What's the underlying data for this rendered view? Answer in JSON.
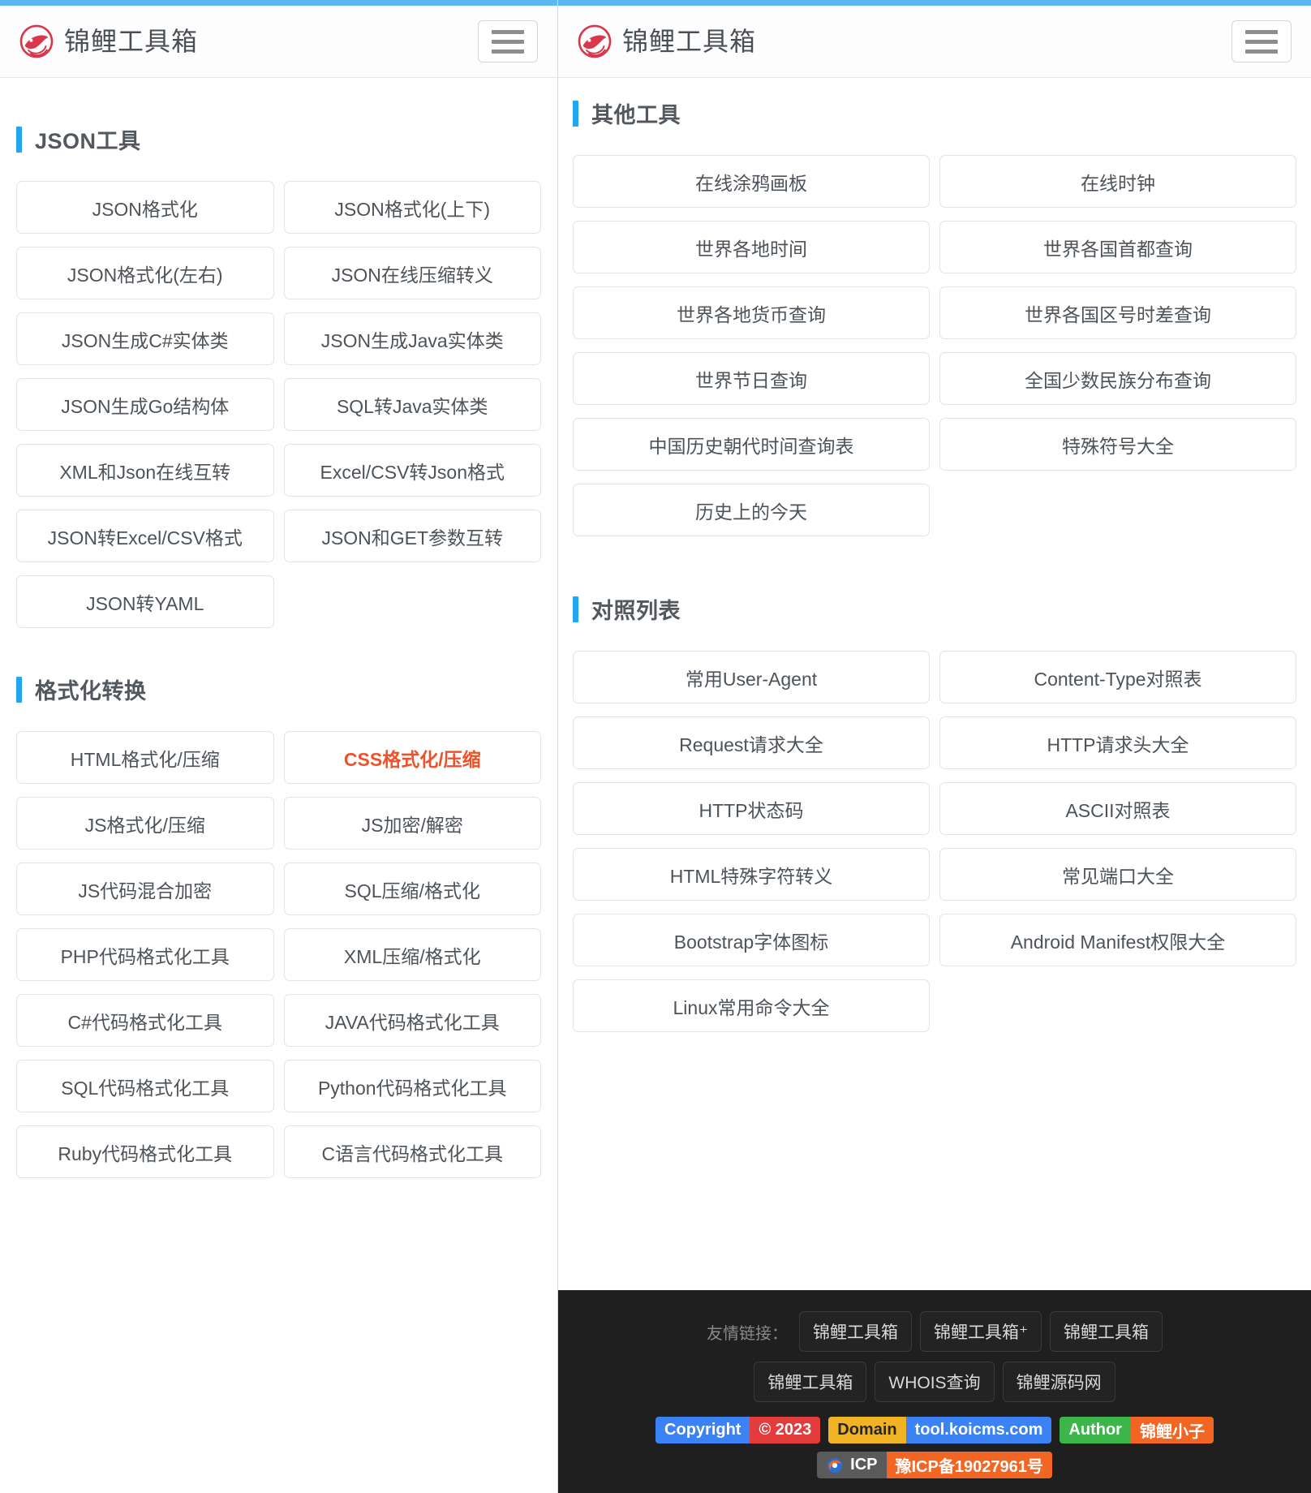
{
  "brand": {
    "title": "锦鲤工具箱",
    "logo_icon": "koi-fish-logo",
    "menu_icon": "hamburger-menu-icon"
  },
  "left_panel": {
    "sections": [
      {
        "title": "JSON工具",
        "items": [
          "JSON格式化",
          "JSON格式化(上下)",
          "JSON格式化(左右)",
          "JSON在线压缩转义",
          "JSON生成C#实体类",
          "JSON生成Java实体类",
          "JSON生成Go结构体",
          "SQL转Java实体类",
          "XML和Json在线互转",
          "Excel/CSV转Json格式",
          "JSON转Excel/CSV格式",
          "JSON和GET参数互转",
          "JSON转YAML"
        ]
      },
      {
        "title": "格式化转换",
        "items": [
          "HTML格式化/压缩",
          "CSS格式化/压缩",
          "JS格式化/压缩",
          "JS加密/解密",
          "JS代码混合加密",
          "SQL压缩/格式化",
          "PHP代码格式化工具",
          "XML压缩/格式化",
          "C#代码格式化工具",
          "JAVA代码格式化工具",
          "SQL代码格式化工具",
          "Python代码格式化工具",
          "Ruby代码格式化工具",
          "C语言代码格式化工具"
        ],
        "active_item": "CSS格式化/压缩"
      }
    ]
  },
  "right_panel": {
    "sections": [
      {
        "title": "其他工具",
        "items": [
          "在线涂鸦画板",
          "在线时钟",
          "世界各地时间",
          "世界各国首都查询",
          "世界各地货币查询",
          "世界各国区号时差查询",
          "世界节日查询",
          "全国少数民族分布查询",
          "中国历史朝代时间查询表",
          "特殊符号大全",
          "历史上的今天"
        ]
      },
      {
        "title": "对照列表",
        "items": [
          "常用User-Agent",
          "Content-Type对照表",
          "Request请求大全",
          "HTTP请求头大全",
          "HTTP状态码",
          "ASCII对照表",
          "HTML特殊字符转义",
          "常见端口大全",
          "Bootstrap字体图标",
          "Android Manifest权限大全",
          "Linux常用命令大全"
        ]
      }
    ]
  },
  "footer": {
    "friend_links_label": "友情链接：",
    "friend_links_row1": [
      "锦鲤工具箱",
      "锦鲤工具箱⁺",
      "锦鲤工具箱"
    ],
    "friend_links_row2": [
      "锦鲤工具箱",
      "WHOIS查询",
      "锦鲤源码网"
    ],
    "badges": {
      "copyright_label": "Copyright",
      "copyright_value": "© 2023",
      "domain_label": "Domain",
      "domain_value": "tool.koicms.com",
      "author_label": "Author",
      "author_value": "锦鲤小子",
      "icp_label": "ICP",
      "icp_value": "豫ICP备19027961号",
      "icp_icon": "icp-swirl-icon"
    },
    "back_to_top_icon": "chevron-up-icon"
  },
  "colors": {
    "accent_blue": "#23a6f0",
    "active_orange": "#f1512a",
    "footer_bg": "#1f1f1f",
    "logo_red": "#d9384a"
  }
}
